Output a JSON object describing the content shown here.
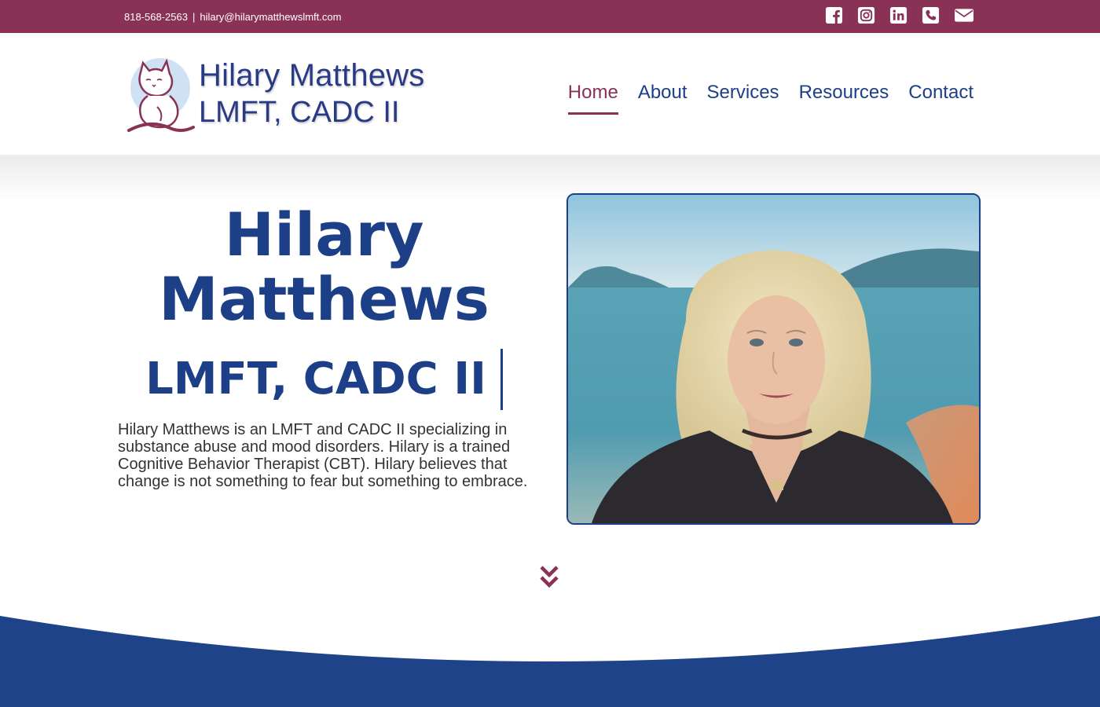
{
  "topbar": {
    "phone": "818-568-2563",
    "separator": "|",
    "email": "hilary@hilarymatthewslmft.com",
    "social_icons": [
      "facebook-icon",
      "instagram-icon",
      "linkedin-icon",
      "phone-icon",
      "email-icon"
    ]
  },
  "brand": {
    "line1": "Hilary Matthews",
    "line2": "LMFT, CADC II",
    "logo_icon": "cat-logo-icon"
  },
  "nav": {
    "items": [
      {
        "label": "Home",
        "active": true
      },
      {
        "label": "About",
        "active": false
      },
      {
        "label": "Services",
        "active": false
      },
      {
        "label": "Resources",
        "active": false
      },
      {
        "label": "Contact",
        "active": false
      }
    ]
  },
  "hero": {
    "name_line1": "Hilary",
    "name_line2": "Matthews",
    "credentials": "LMFT, CADC II",
    "bio": "Hilary Matthews is an LMFT and CADC II specializing in substance abuse and mood disorders. Hilary is a trained Cognitive Behavior Therapist (CBT). Hilary believes that change is not something to fear but something to embrace.",
    "photo_alt": "Hilary Matthews"
  },
  "colors": {
    "primary_blue": "#1c3f87",
    "accent_burgundy": "#8a3156",
    "wave_blue": "#1e4388"
  }
}
